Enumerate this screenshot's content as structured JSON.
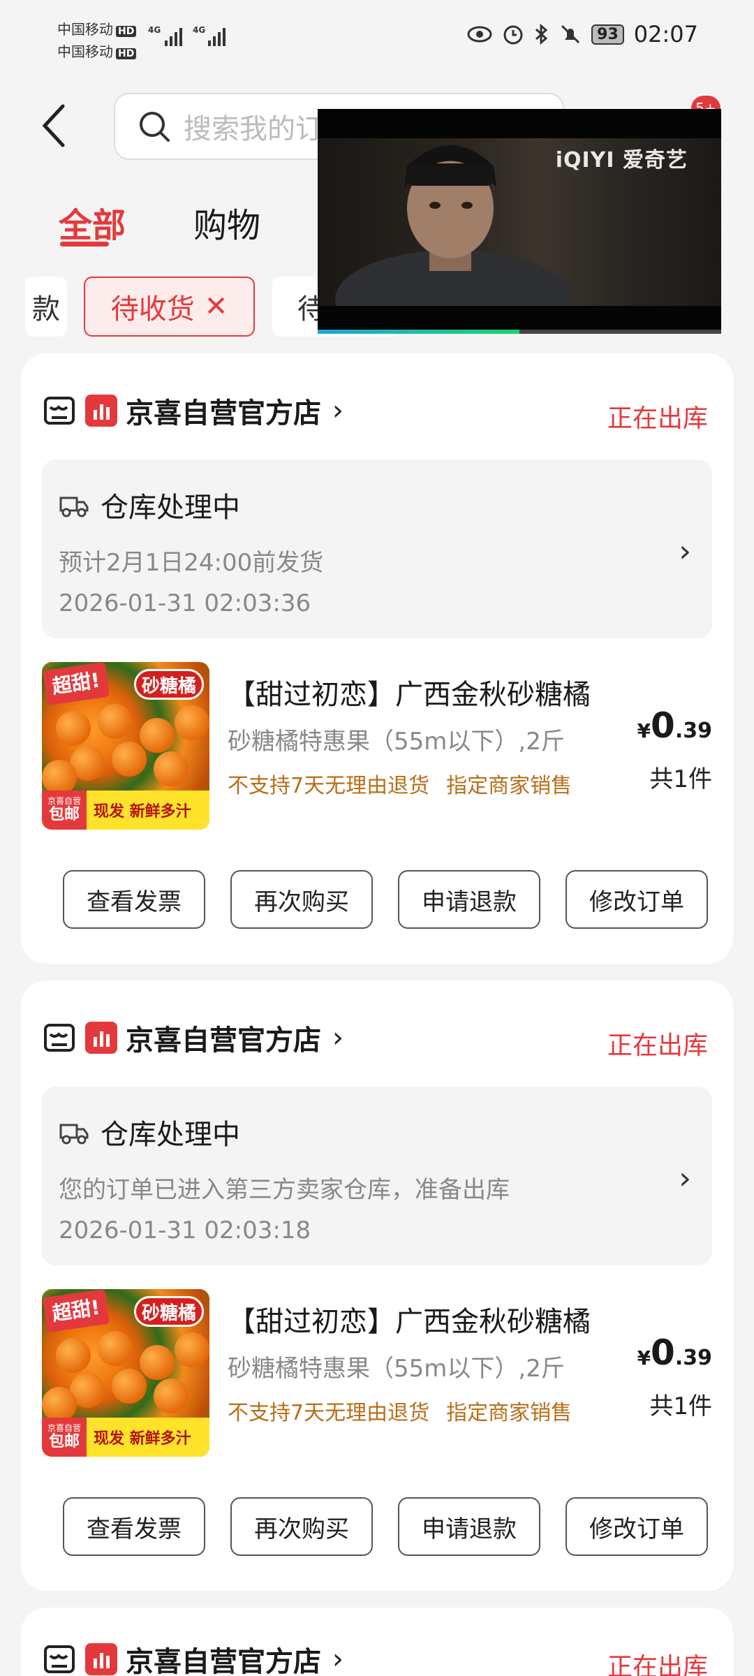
{
  "status_bar": {
    "carrier1": "中国移动",
    "carrier2": "中国移动",
    "hd": "HD",
    "net": "4G",
    "battery": "93",
    "time": "02:07"
  },
  "header": {
    "search_placeholder": "搜索我的订单",
    "message_badge": "5+"
  },
  "tabs": [
    {
      "label": "全部",
      "active": true
    },
    {
      "label": "购物",
      "active": false
    }
  ],
  "filters": [
    {
      "label": "款",
      "active": false
    },
    {
      "label": "待收货",
      "active": true,
      "close": "✕"
    },
    {
      "label": "待",
      "active": false
    }
  ],
  "video": {
    "logo": "iQIYI 爱奇艺",
    "progress": 0.5
  },
  "orders": [
    {
      "shop_name": "京喜自营官方店",
      "status": "正在出库",
      "logistics_title": "仓库处理中",
      "logistics_desc": "预计2月1日24:00前发货",
      "logistics_time": "2026-01-31 02:03:36",
      "product_title": "【甜过初恋】广西金秋砂糖橘",
      "product_spec": "砂糖橘特惠果（55m以下）,2斤",
      "tag1": "不支持7天无理由退货",
      "tag2": "指定商家销售",
      "price_symbol": "¥",
      "price_int": "0",
      "price_dec": ".39",
      "quantity": "共1件",
      "img_tag1": "超甜!",
      "img_tag2": "砂糖橘",
      "img_badge_small": "京喜自营",
      "img_badge": "包邮",
      "img_slogan": "现发  新鲜多汁",
      "buttons": [
        "查看发票",
        "再次购买",
        "申请退款",
        "修改订单"
      ]
    },
    {
      "shop_name": "京喜自营官方店",
      "status": "正在出库",
      "logistics_title": "仓库处理中",
      "logistics_desc": "您的订单已进入第三方卖家仓库，准备出库",
      "logistics_time": "2026-01-31 02:03:18",
      "product_title": "【甜过初恋】广西金秋砂糖橘",
      "product_spec": "砂糖橘特惠果（55m以下）,2斤",
      "tag1": "不支持7天无理由退货",
      "tag2": "指定商家销售",
      "price_symbol": "¥",
      "price_int": "0",
      "price_dec": ".39",
      "quantity": "共1件",
      "img_tag1": "超甜!",
      "img_tag2": "砂糖橘",
      "img_badge_small": "京喜自营",
      "img_badge": "包邮",
      "img_slogan": "现发  新鲜多汁",
      "buttons": [
        "查看发票",
        "再次购买",
        "申请退款",
        "修改订单"
      ]
    },
    {
      "shop_name": "京喜自营官方店",
      "status": "正在出库"
    }
  ]
}
